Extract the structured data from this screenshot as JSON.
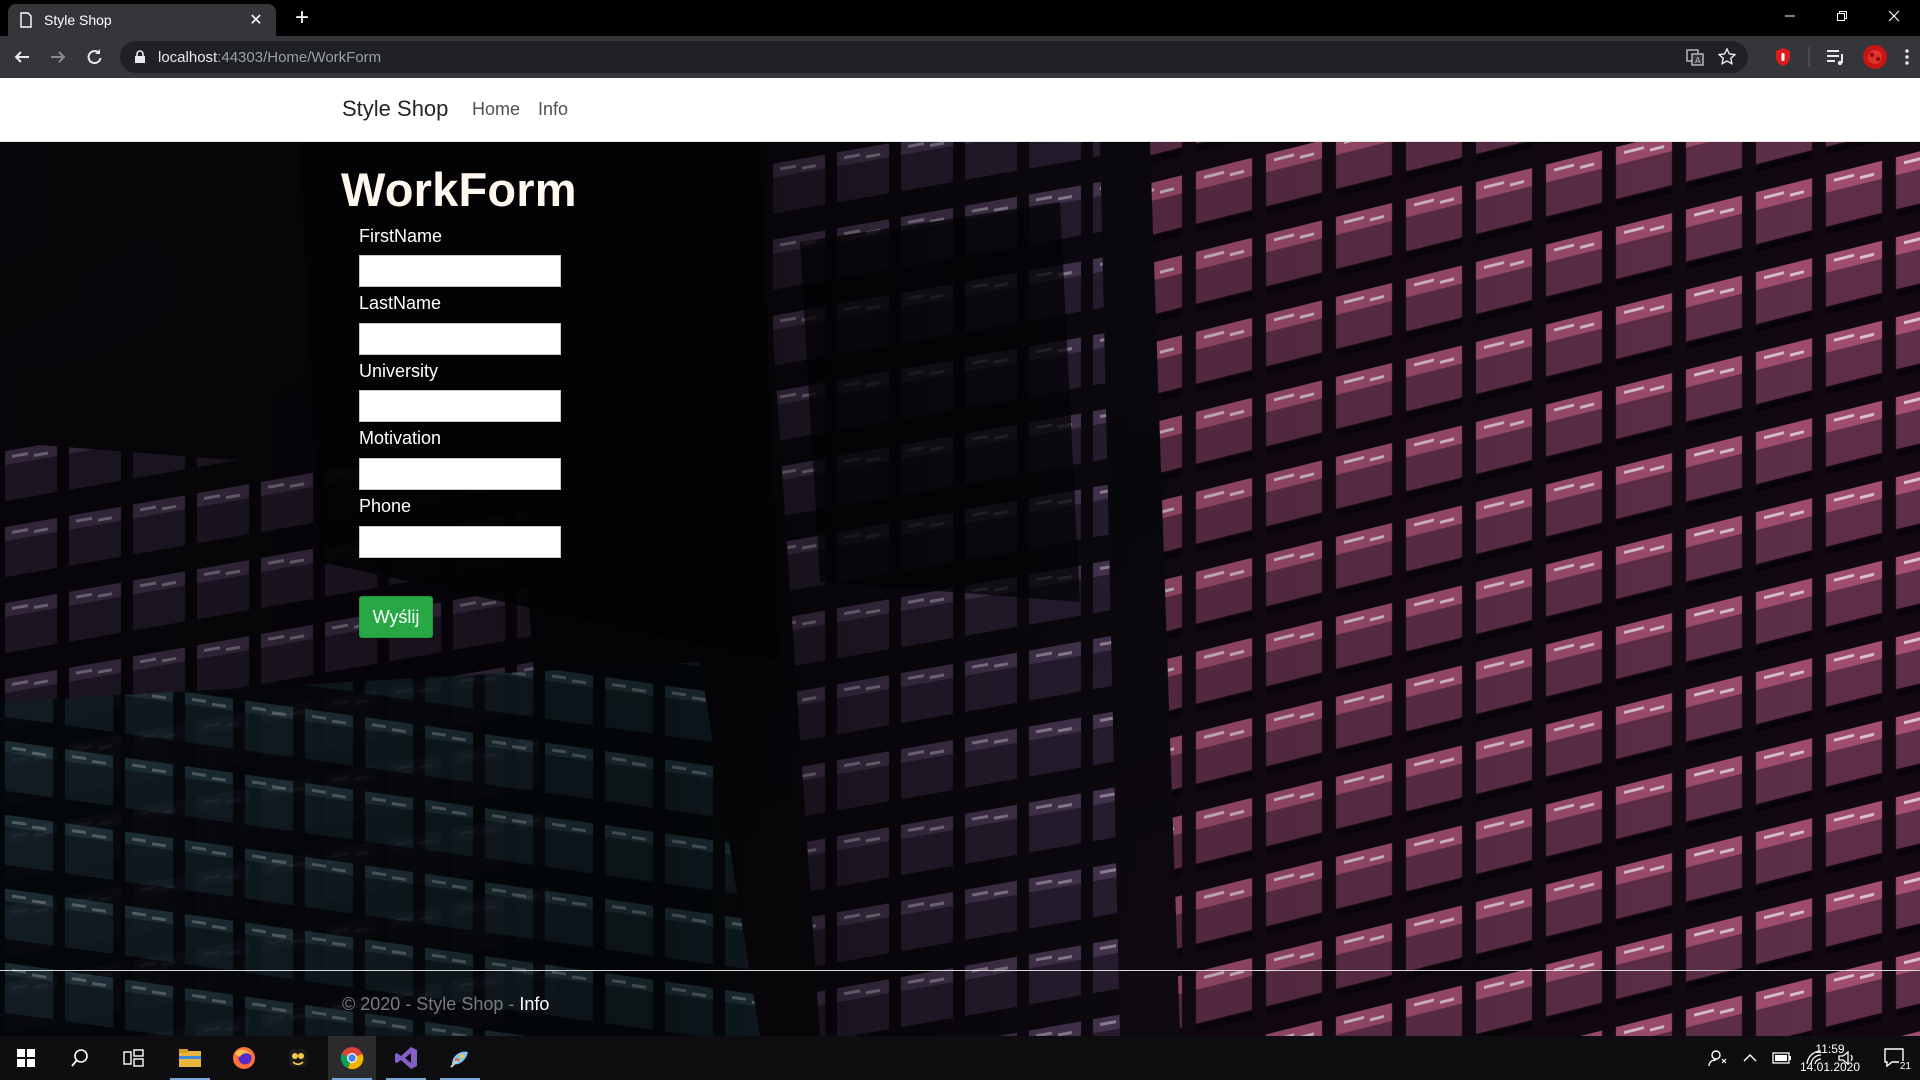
{
  "browser": {
    "tab_title": "Style Shop",
    "url_host": "localhost",
    "url_rest": ":44303/Home/WorkForm"
  },
  "site": {
    "brand": "Style Shop",
    "nav": [
      "Home",
      "Info"
    ]
  },
  "form": {
    "title": "WorkForm",
    "fields": [
      {
        "label": "FirstName",
        "value": ""
      },
      {
        "label": "LastName",
        "value": ""
      },
      {
        "label": "University",
        "value": ""
      },
      {
        "label": "Motivation",
        "value": ""
      },
      {
        "label": "Phone",
        "value": ""
      }
    ],
    "submit_label": "Wyślij"
  },
  "footer": {
    "text": "© 2020 - Style Shop - ",
    "link": "Info"
  },
  "taskbar": {
    "time": "11:59",
    "date": "14.01.2020",
    "notification_count": "21"
  },
  "colors": {
    "submit_green": "#28a745",
    "chrome_bar": "#35363a",
    "taskbar": "#0e0e10"
  }
}
